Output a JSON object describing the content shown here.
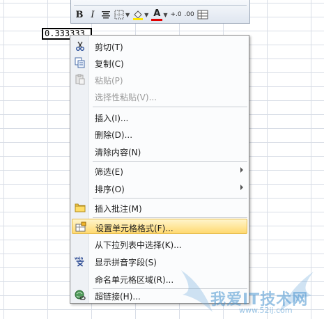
{
  "cell": {
    "value": "0.333333"
  },
  "mini_toolbar": {
    "bold": "B",
    "italic": "I",
    "font_color": "A",
    "increase_decimal": "+.0",
    "decrease_decimal": ".00"
  },
  "context_menu": {
    "items": [
      {
        "label": "剪切(T)",
        "icon": "scissors-icon",
        "enabled": true
      },
      {
        "label": "复制(C)",
        "icon": "copy-icon",
        "enabled": true
      },
      {
        "label": "粘贴(P)",
        "icon": "paste-icon",
        "enabled": false
      },
      {
        "label": "选择性粘贴(V)...",
        "icon": "",
        "enabled": false
      },
      {
        "label": "插入(I)...",
        "icon": "",
        "enabled": true
      },
      {
        "label": "删除(D)...",
        "icon": "",
        "enabled": true
      },
      {
        "label": "清除内容(N)",
        "icon": "",
        "enabled": true
      },
      {
        "label": "筛选(E)",
        "icon": "",
        "enabled": true,
        "submenu": true
      },
      {
        "label": "排序(O)",
        "icon": "",
        "enabled": true,
        "submenu": true
      },
      {
        "label": "插入批注(M)",
        "icon": "comment-icon",
        "enabled": true
      },
      {
        "label": "设置单元格格式(F)...",
        "icon": "format-cells-icon",
        "enabled": true,
        "highlighted": true
      },
      {
        "label": "从下拉列表中选择(K)...",
        "icon": "",
        "enabled": true
      },
      {
        "label": "显示拼音字段(S)",
        "icon": "phonetic-icon",
        "icon_text": "wén",
        "enabled": true
      },
      {
        "label": "命名单元格区域(R)...",
        "icon": "",
        "enabled": true
      },
      {
        "label": "超链接(H)...",
        "icon": "hyperlink-icon",
        "enabled": true
      }
    ]
  },
  "watermark": {
    "text": "我爱IT技术网",
    "url": "www.52ij.com"
  },
  "colors": {
    "highlight": "#ffd970",
    "font_color_bar": "#e00000",
    "grid": "#d8dde6"
  }
}
